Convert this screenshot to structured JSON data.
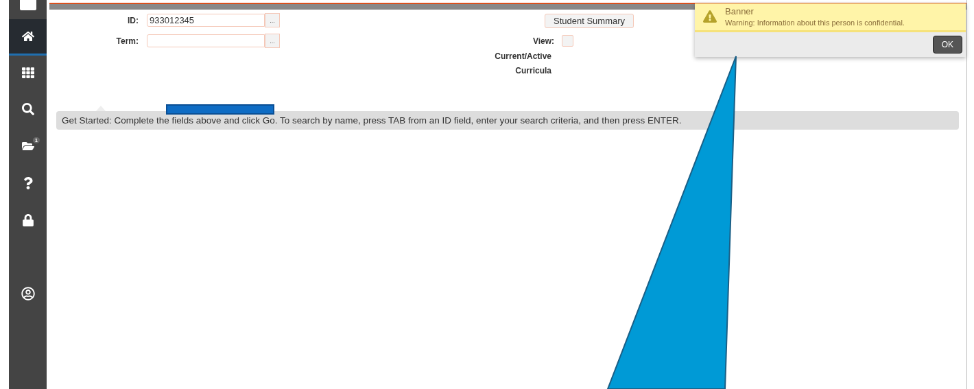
{
  "sidebar": {
    "items": [
      {
        "kind": "top",
        "selected": false
      },
      {
        "kind": "home",
        "selected": true
      },
      {
        "kind": "grid",
        "selected": false
      },
      {
        "kind": "search",
        "selected": false
      },
      {
        "kind": "folder",
        "selected": false,
        "badge": "1"
      },
      {
        "kind": "help",
        "selected": false
      },
      {
        "kind": "lock",
        "selected": false
      },
      {
        "kind": "user",
        "selected": false
      }
    ]
  },
  "form": {
    "fields": [
      {
        "label": "ID:",
        "value": "933012345",
        "button": "..."
      },
      {
        "label": "Term:",
        "button": "..."
      }
    ],
    "summary_button": "Student Summary",
    "view": {
      "label": "View:",
      "checked": false
    },
    "labels": [
      "Current/Active",
      "Curricula"
    ]
  },
  "hint": "Get Started: Complete the fields above and click Go. To search by name, press TAB from an ID field, enter your search criteria, and then press ENTER.",
  "notification": {
    "title": "Banner",
    "message": "Warning: Information about this person is confidential.",
    "button": "OK"
  }
}
